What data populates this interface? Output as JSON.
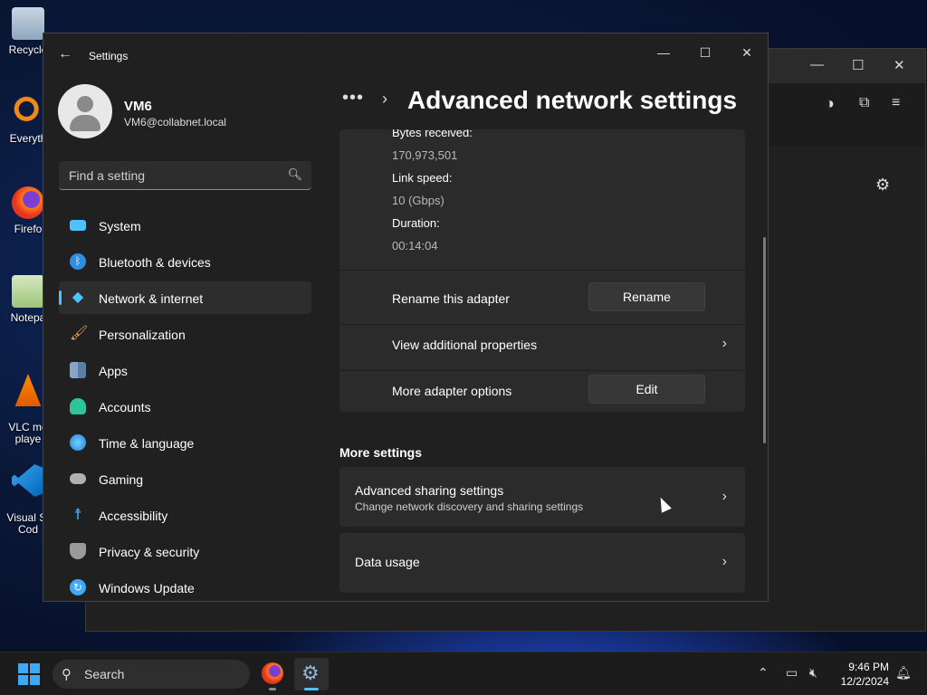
{
  "desktop": {
    "icons": [
      {
        "label": "Recycle"
      },
      {
        "label": "Everyth"
      },
      {
        "label": "Firefo"
      },
      {
        "label": "Notepa"
      },
      {
        "label": "VLC me\nplaye"
      },
      {
        "label": "Visual St\nCod"
      }
    ]
  },
  "settings": {
    "app_title": "Settings",
    "user": {
      "name": "VM6",
      "email": "VM6@collabnet.local"
    },
    "search_placeholder": "Find a setting",
    "nav": [
      {
        "label": "System",
        "icon": "monitor-icon",
        "color": "#4cc2ff",
        "active": false
      },
      {
        "label": "Bluetooth & devices",
        "icon": "bluetooth-icon",
        "color": "#2f8de4",
        "active": false
      },
      {
        "label": "Network & internet",
        "icon": "wifi-icon",
        "color": "#4cc2ff",
        "active": true
      },
      {
        "label": "Personalization",
        "icon": "brush-icon",
        "color": "#e8a25a",
        "active": false
      },
      {
        "label": "Apps",
        "icon": "apps-icon",
        "color": "#8aa4c8",
        "active": false
      },
      {
        "label": "Accounts",
        "icon": "person-icon",
        "color": "#2fc39a",
        "active": false
      },
      {
        "label": "Time & language",
        "icon": "globe-clock-icon",
        "color": "#3fa9f5",
        "active": false
      },
      {
        "label": "Gaming",
        "icon": "gamepad-icon",
        "color": "#b0b0b0",
        "active": false
      },
      {
        "label": "Accessibility",
        "icon": "accessibility-icon",
        "color": "#3fa9f5",
        "active": false
      },
      {
        "label": "Privacy & security",
        "icon": "shield-icon",
        "color": "#9a9a9a",
        "active": false
      },
      {
        "label": "Windows Update",
        "icon": "update-icon",
        "color": "#3fa9f5",
        "active": false
      }
    ],
    "breadcrumb_overflow": "•••",
    "page_title": "Advanced network settings",
    "adapter_details": [
      {
        "label": "Bytes received:",
        "value": "170,973,501"
      },
      {
        "label": "Link speed:",
        "value": "10 (Gbps)"
      },
      {
        "label": "Duration:",
        "value": "00:14:04"
      }
    ],
    "rename_row": {
      "label": "Rename this adapter",
      "button": "Rename"
    },
    "view_props_row": {
      "label": "View additional properties"
    },
    "adapter_options_row": {
      "label": "More adapter options",
      "button": "Edit"
    },
    "more_settings": {
      "title": "More settings",
      "items": [
        {
          "title": "Advanced sharing settings",
          "subtitle": "Change network discovery and sharing settings"
        },
        {
          "title": "Data usage",
          "subtitle": ""
        }
      ]
    }
  },
  "taskbar": {
    "search_label": "Search",
    "time": "9:46 PM",
    "date": "12/2/2024"
  }
}
